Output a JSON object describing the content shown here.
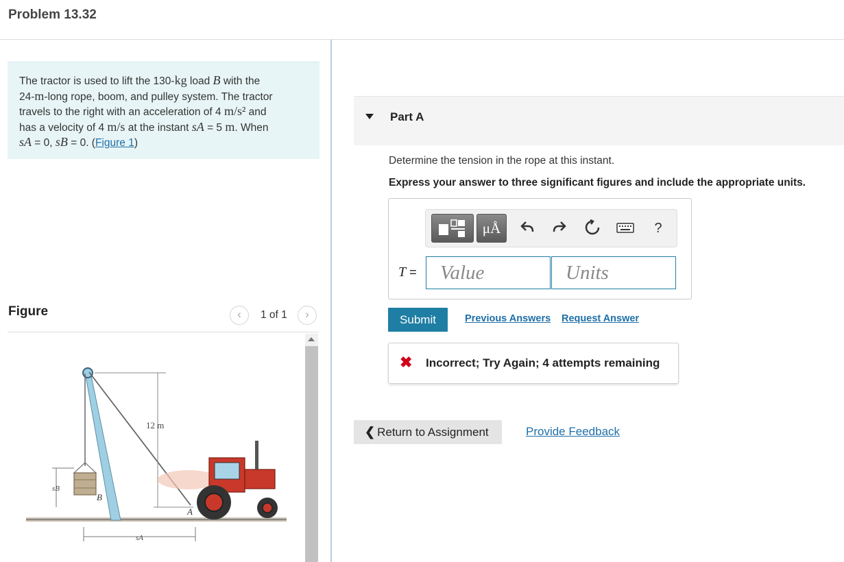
{
  "header": {
    "title": "Problem 13.32"
  },
  "problem": {
    "t1": "The tractor is used to lift the 130-",
    "kg": "kg",
    "t2": " load ",
    "B": "B",
    "t3": " with the",
    "t4": "24-",
    "m": "m",
    "t5": "-long rope, boom, and pulley system. The tractor",
    "t6": "travels to the right with an acceleration of 4 ",
    "accel_unit": "m/s²",
    "t7": " and",
    "t8": "has a velocity of 4 ",
    "vel_unit": "m/s",
    "t9": " at the instant ",
    "sA": "sA",
    "t10": " = 5 ",
    "m2": "m",
    "t11": ". When",
    "sA2": "sA",
    "t12": " = 0, ",
    "sB": "sB",
    "t13": " = 0. (",
    "figure_link": "Figure 1",
    "t14": ")"
  },
  "figure_panel": {
    "label": "Figure",
    "prev_icon": "‹",
    "next_icon": "›",
    "counter": "1 of 1",
    "labels": {
      "height": "12 m",
      "sB": "sB",
      "sA": "sA",
      "B": "B",
      "A": "A"
    }
  },
  "part": {
    "title": "Part A"
  },
  "question": "Determine the tension in the rope at this instant.",
  "instruction": "Express your answer to three significant figures and include the appropriate units.",
  "toolbar": {
    "units_label": "μÅ",
    "help": "?"
  },
  "answer": {
    "variable": "T",
    "equals": " =",
    "value_placeholder": "Value",
    "units_placeholder": "Units"
  },
  "actions": {
    "submit": "Submit",
    "previous_answers": "Previous Answers",
    "request_answer": "Request Answer"
  },
  "feedback": {
    "icon": "✖",
    "message": "Incorrect; Try Again; 4 attempts remaining"
  },
  "footer": {
    "return_icon": "❮",
    "return_label": "Return to Assignment",
    "provide_feedback": "Provide Feedback"
  }
}
